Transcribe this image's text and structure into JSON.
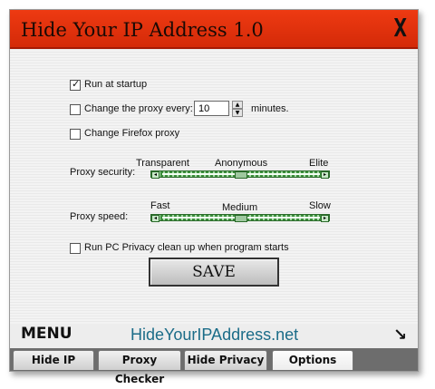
{
  "window": {
    "title": "Hide Your IP Address 1.0",
    "close_label": "X"
  },
  "options": {
    "run_at_startup": {
      "label": "Run at startup",
      "checked": true
    },
    "change_proxy": {
      "label": "Change the proxy every:",
      "value": "10",
      "suffix": "minutes.",
      "checked": false
    },
    "change_firefox": {
      "label": "Change Firefox proxy",
      "checked": false
    },
    "pc_privacy": {
      "label": "Run PC Privacy clean up when program starts",
      "checked": false
    }
  },
  "proxy_security": {
    "label": "Proxy security:",
    "ticks": [
      "Transparent",
      "Anonymous",
      "Elite"
    ],
    "level": 0.5
  },
  "proxy_speed": {
    "label": "Proxy speed:",
    "ticks": [
      "Fast",
      "Medium",
      "Slow"
    ],
    "level": 0.5
  },
  "save_label": "SAVE",
  "footer": {
    "menu": "MENU",
    "site": "HideYourIPAddress.net"
  },
  "tabs": [
    {
      "label": "Hide IP"
    },
    {
      "label": "Proxy Checker"
    },
    {
      "label": "Hide Privacy"
    },
    {
      "label": "Options",
      "active": true
    }
  ],
  "colors": {
    "titlebar": "#e23410",
    "accent_green": "#3b8e3b",
    "site_text": "#1b6c88"
  }
}
